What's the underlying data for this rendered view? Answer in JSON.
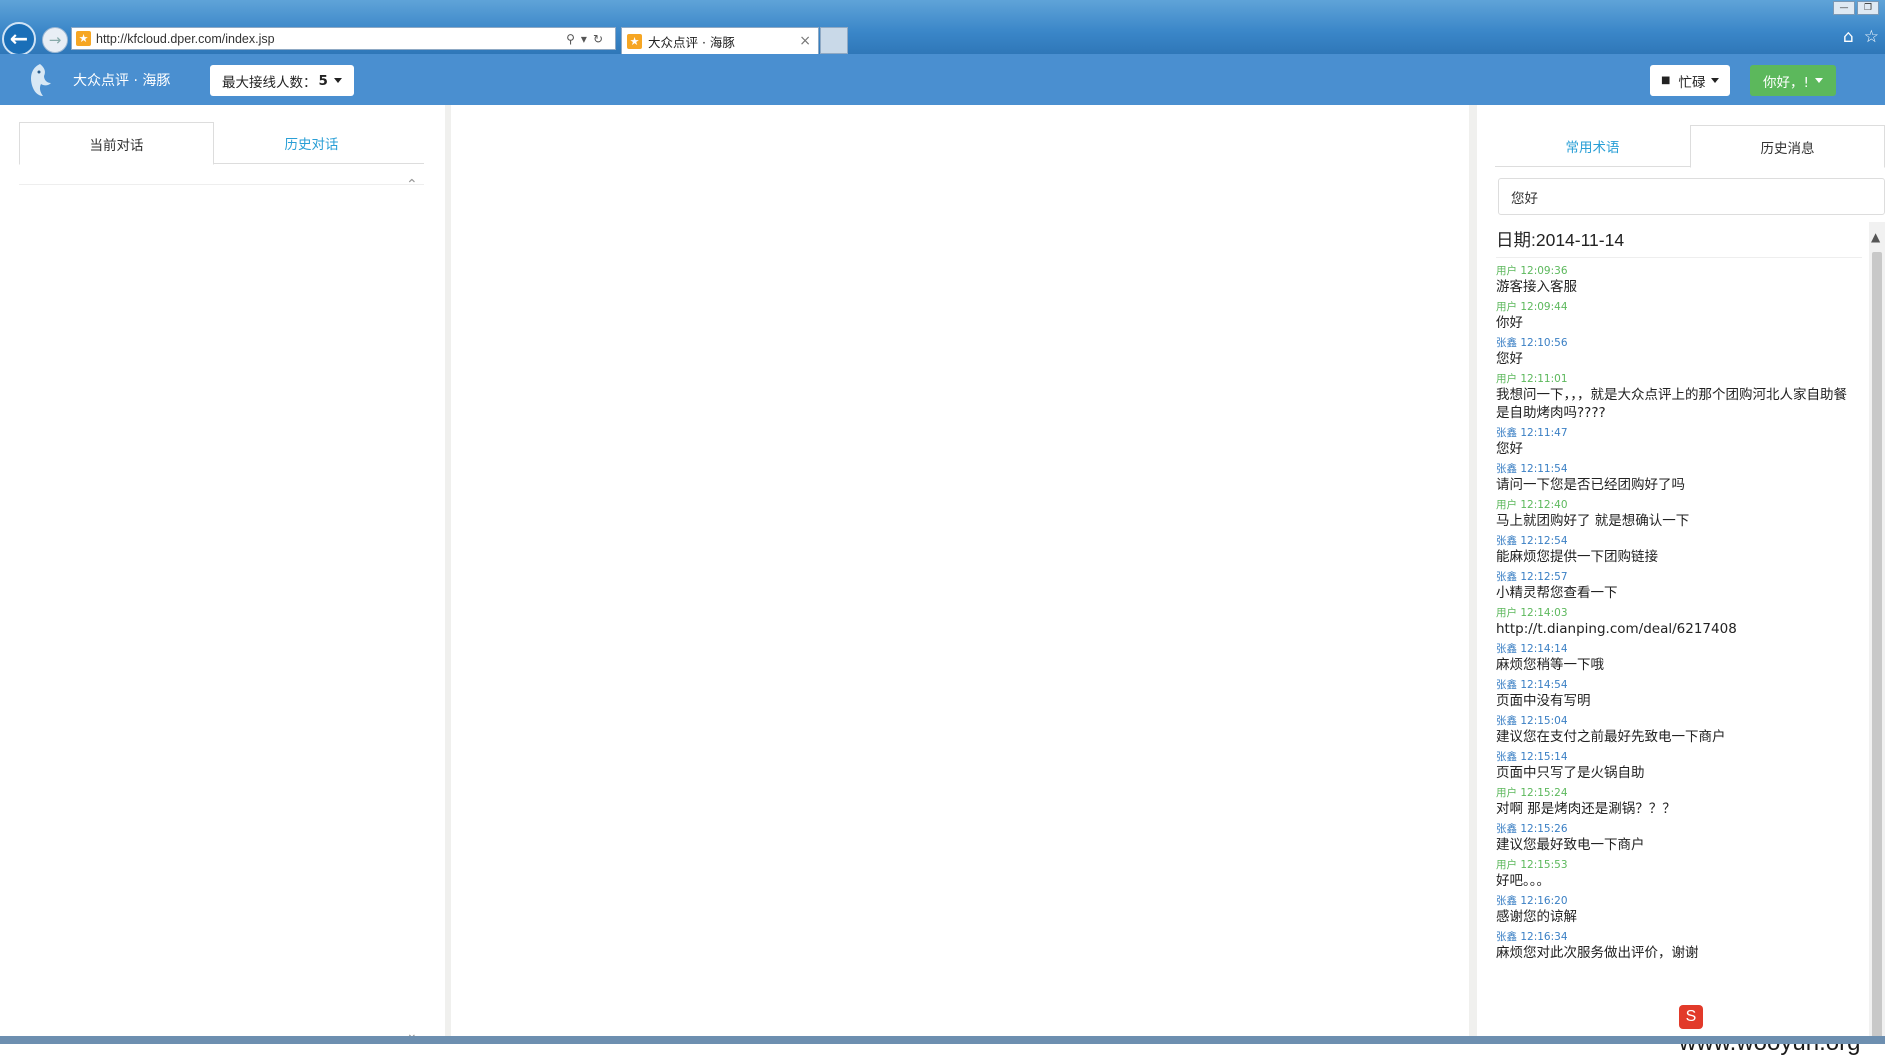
{
  "browser": {
    "back_icon": "back-arrow-icon",
    "forward_icon": "forward-arrow-icon",
    "url": "http://kfcloud.dper.com/index.jsp",
    "tab_title": "大众点评 · 海豚",
    "tab_close": "×",
    "right_icons": [
      "home-icon",
      "star-icon"
    ]
  },
  "header": {
    "title": "大众点评 · 海豚",
    "max_label": "最大接线人数：",
    "max_value": "5",
    "status_label": "忙碌",
    "user_label": "你好，!",
    "accent_color": "#4a8fd0",
    "user_button_color": "#5cb85c"
  },
  "left_panel": {
    "tabs": [
      {
        "label": "当前对话",
        "active": true
      },
      {
        "label": "历史对话",
        "active": false
      }
    ]
  },
  "right_panel": {
    "tabs": [
      {
        "label": "常用术语",
        "active": false
      },
      {
        "label": "历史消息",
        "active": true
      }
    ],
    "search_value": "您好",
    "date_label": "日期:2014-11-14",
    "messages": [
      {
        "role": "user",
        "meta": "用户 12:09:36",
        "text": "游客接入客服"
      },
      {
        "role": "user",
        "meta": "用户 12:09:44",
        "text": "你好"
      },
      {
        "role": "agent",
        "meta": "张鑫 12:10:56",
        "text": "您好"
      },
      {
        "role": "user",
        "meta": "用户 12:11:01",
        "text": "我想问一下，，，就是大众点评上的那个团购河北人家自助餐   是自助烤肉吗????"
      },
      {
        "role": "agent",
        "meta": "张鑫 12:11:47",
        "text": "您好"
      },
      {
        "role": "agent",
        "meta": "张鑫 12:11:54",
        "text": "请问一下您是否已经团购好了吗"
      },
      {
        "role": "user",
        "meta": "用户 12:12:40",
        "text": "马上就团购好了    就是想确认一下"
      },
      {
        "role": "agent",
        "meta": "张鑫 12:12:54",
        "text": "能麻烦您提供一下团购链接"
      },
      {
        "role": "agent",
        "meta": "张鑫 12:12:57",
        "text": "小精灵帮您查看一下"
      },
      {
        "role": "user",
        "meta": "用户 12:14:03",
        "text": "http://t.dianping.com/deal/6217408"
      },
      {
        "role": "agent",
        "meta": "张鑫 12:14:14",
        "text": "麻烦您稍等一下哦"
      },
      {
        "role": "agent",
        "meta": "张鑫 12:14:54",
        "text": "页面中没有写明"
      },
      {
        "role": "agent",
        "meta": "张鑫 12:15:04",
        "text": "建议您在支付之前最好先致电一下商户"
      },
      {
        "role": "agent",
        "meta": "张鑫 12:15:14",
        "text": "页面中只写了是火锅自助"
      },
      {
        "role": "user",
        "meta": "用户 12:15:24",
        "text": "对啊   那是烤肉还是涮锅？？？"
      },
      {
        "role": "agent",
        "meta": "张鑫 12:15:26",
        "text": "建议您最好致电一下商户"
      },
      {
        "role": "user",
        "meta": "用户 12:15:53",
        "text": "好吧。。。"
      },
      {
        "role": "agent",
        "meta": "张鑫 12:16:20",
        "text": "感谢您的谅解"
      },
      {
        "role": "agent",
        "meta": "张鑫 12:16:34",
        "text": "麻烦您对此次服务做出评价，谢谢"
      }
    ]
  },
  "watermark": "www.wooyun.org",
  "watermark_ime": "S"
}
